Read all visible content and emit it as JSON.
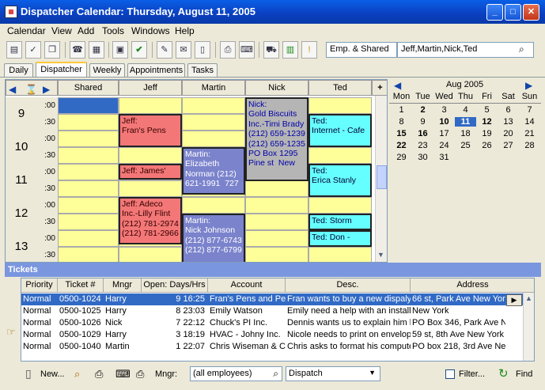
{
  "window": {
    "title": "Dispatcher Calendar: Thursday, August 11, 2005",
    "min": "_",
    "max": "□",
    "close": "✕"
  },
  "menu": [
    "Calendar",
    "View",
    "Add",
    "Tools",
    "Windows",
    "Help"
  ],
  "toolbar": {
    "employee_mode": "Emp. & Shared",
    "employee_list": "Jeff,Martin,Nick,Ted"
  },
  "tabs": [
    "Daily",
    "Dispatcher",
    "Weekly",
    "Appointments",
    "Tasks"
  ],
  "active_tab": "Dispatcher",
  "schedule": {
    "columns": [
      "Shared",
      "Jeff",
      "Martin",
      "Nick",
      "Ted"
    ],
    "hours": [
      "9",
      "10",
      "11",
      "12",
      "13"
    ],
    "minutes": [
      ":00",
      ":30"
    ],
    "events": {
      "jeff1": "Jeff:\nFran's Pens",
      "jeff2": "Jeff: James'",
      "jeff3": "Jeff: Adeco\nInc.-Lilly Flint\n(212) 781-2974\n(212) 781-2966",
      "martin1": "Martin:\nElizabeth\nNorman (212)\n621-1991  727",
      "martin2": "Martin:\nNick Johnson\n(212) 877-6743\n(212) 877-6799",
      "nick1": "Nick:\nGold Biscuits\nInc.-Timi Brady\n(212) 659-1239\n(212) 659-1235\nPO Box 1295\nPine st  New",
      "ted1": "Ted:\nInternet - Cafe",
      "ted2": "Ted:\nErica Stanly",
      "ted3": "Ted: Storm",
      "ted4": "Ted: Don -"
    }
  },
  "calendar": {
    "month": "Aug 2005",
    "weekdays": [
      "Mon",
      "Tue",
      "Wed",
      "Thu",
      "Fri",
      "Sat",
      "Sun"
    ],
    "weeks": [
      [
        "1",
        "2",
        "3",
        "4",
        "5",
        "6",
        "7"
      ],
      [
        "8",
        "9",
        "10",
        "11",
        "12",
        "13",
        "14"
      ],
      [
        "15",
        "16",
        "17",
        "18",
        "19",
        "20",
        "21"
      ],
      [
        "22",
        "23",
        "24",
        "25",
        "26",
        "27",
        "28"
      ],
      [
        "29",
        "30",
        "31",
        "",
        "",
        "",
        ""
      ]
    ],
    "selected": "11"
  },
  "tickets": {
    "title": "Tickets",
    "headers": [
      "Priority",
      "Ticket #",
      "Mngr",
      "Open: Days/Hrs",
      "Account",
      "Desc.",
      "Address"
    ],
    "rows": [
      [
        "Normal",
        "0500-1024",
        "Harry",
        "9 16:25",
        "Fran's Pens and Per",
        "Fran wants to buy a new dispaly.",
        "66 st, Park Ave  New York"
      ],
      [
        "Normal",
        "0500-1025",
        "Harry",
        "8 23:03",
        "Emily Watson",
        "Emily need a help with an installa",
        "New York"
      ],
      [
        "Normal",
        "0500-1026",
        "Nick",
        "7 22:12",
        "Chuck's PI Inc.",
        "Dennis wants us to explain him h",
        "PO Box 346, Park Ave  New Y"
      ],
      [
        "Normal",
        "0500-1029",
        "Harry",
        "3 18:19",
        "HVAC - Johny Inc.",
        "Nicole needs to print on envelope",
        "59 st, 8th Ave  New York 474"
      ],
      [
        "Normal",
        "0500-1040",
        "Martin",
        "1 22:07",
        "Chris Wiseman & Co",
        "Chris asks to format his computer",
        "PO box 218, 3rd Ave  New Yo"
      ]
    ]
  },
  "bottom": {
    "new": "New...",
    "mngr_label": "Mngr:",
    "mngr_value": "(all employees)",
    "view_select": "Dispatch",
    "filter": "Filter...",
    "find": "Find"
  }
}
